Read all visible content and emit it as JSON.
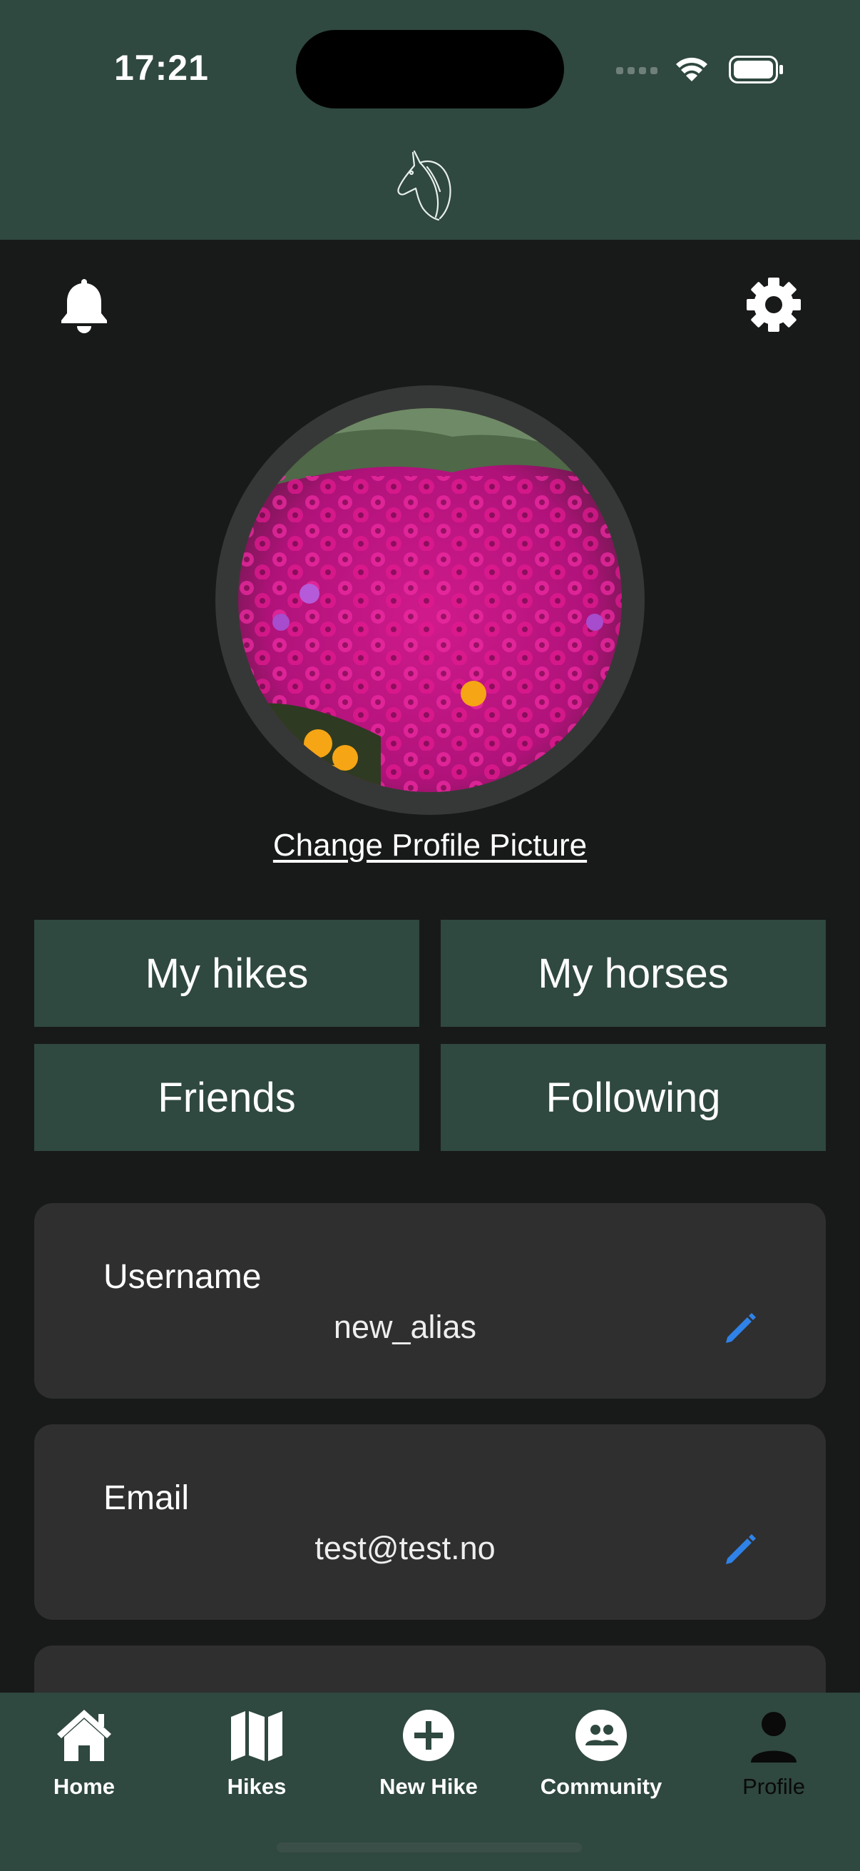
{
  "status_bar": {
    "time": "17:21"
  },
  "header": {
    "logo_icon": "horse-head-icon"
  },
  "top_actions": {
    "notifications_icon": "bell-icon",
    "settings_icon": "gear-icon"
  },
  "profile": {
    "change_picture_label": "Change Profile Picture"
  },
  "tiles": {
    "my_hikes": "My hikes",
    "my_horses": "My horses",
    "friends": "Friends",
    "following": "Following"
  },
  "fields": [
    {
      "label": "Username",
      "value": "new_alias"
    },
    {
      "label": "Email",
      "value": "test@test.no"
    }
  ],
  "bottom_nav": [
    {
      "label": "Home",
      "icon": "home-icon"
    },
    {
      "label": "Hikes",
      "icon": "map-icon"
    },
    {
      "label": "New Hike",
      "icon": "plus-circle-icon"
    },
    {
      "label": "Community",
      "icon": "community-icon"
    },
    {
      "label": "Profile",
      "icon": "person-icon",
      "active": true
    }
  ],
  "colors": {
    "header_bg": "#2f4840",
    "page_bg": "#181a19",
    "card_bg": "#2f2f2f",
    "edit_accent": "#2f82e8"
  }
}
